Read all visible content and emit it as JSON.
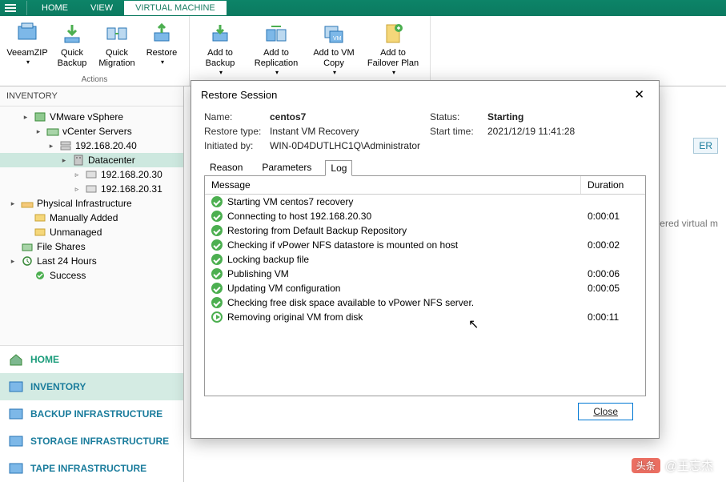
{
  "menubar": {
    "tabs": [
      "HOME",
      "VIEW",
      "VIRTUAL MACHINE"
    ],
    "active": 2
  },
  "ribbon": {
    "groups": [
      {
        "label": "Actions",
        "items": [
          {
            "label": "VeeamZIP",
            "hasDrop": true
          },
          {
            "label": "Quick Backup"
          },
          {
            "label": "Quick Migration"
          },
          {
            "label": "Restore",
            "hasDrop": true
          }
        ]
      },
      {
        "label": "",
        "items": [
          {
            "label": "Add to Backup",
            "hasDrop": true
          },
          {
            "label": "Add to Replication",
            "hasDrop": true
          },
          {
            "label": "Add to VM Copy",
            "hasDrop": true
          },
          {
            "label": "Add to Failover Plan",
            "hasDrop": true
          }
        ]
      }
    ]
  },
  "sidebar": {
    "title": "INVENTORY",
    "tree": [
      {
        "depth": 1,
        "toggle": "▸",
        "icon": "vi",
        "label": "VMware vSphere"
      },
      {
        "depth": 2,
        "toggle": "▸",
        "icon": "vc",
        "label": "vCenter Servers"
      },
      {
        "depth": 3,
        "toggle": "▸",
        "icon": "srv",
        "label": "192.168.20.40"
      },
      {
        "depth": 4,
        "toggle": "▸",
        "icon": "dc",
        "label": "Datacenter",
        "selected": true
      },
      {
        "depth": 5,
        "toggle": "▹",
        "icon": "host",
        "label": "192.168.20.30"
      },
      {
        "depth": 5,
        "toggle": "▹",
        "icon": "host",
        "label": "192.168.20.31"
      },
      {
        "depth": 0,
        "toggle": "▸",
        "icon": "phys",
        "label": "Physical Infrastructure"
      },
      {
        "depth": 1,
        "toggle": "",
        "icon": "man",
        "label": "Manually Added"
      },
      {
        "depth": 1,
        "toggle": "",
        "icon": "unm",
        "label": "Unmanaged"
      },
      {
        "depth": 0,
        "toggle": "",
        "icon": "fs",
        "label": "File Shares"
      },
      {
        "depth": 0,
        "toggle": "▸",
        "icon": "hist",
        "label": "Last 24 Hours"
      },
      {
        "depth": 1,
        "toggle": "",
        "icon": "succ",
        "label": "Success"
      }
    ],
    "nav": [
      {
        "label": "HOME",
        "type": "home"
      },
      {
        "label": "INVENTORY",
        "type": "section",
        "active": true
      },
      {
        "label": "BACKUP INFRASTRUCTURE",
        "type": "section"
      },
      {
        "label": "STORAGE INFRASTRUCTURE",
        "type": "section"
      },
      {
        "label": "TAPE INFRASTRUCTURE",
        "type": "section"
      }
    ]
  },
  "content": {
    "fragHeader": "ER",
    "fragText": "vered virtual m"
  },
  "dialog": {
    "title": "Restore Session",
    "info": {
      "name_label": "Name:",
      "name": "centos7",
      "type_label": "Restore type:",
      "type": "Instant VM Recovery",
      "init_label": "Initiated by:",
      "init": "WIN-0D4DUTLHC1Q\\Administrator",
      "status_label": "Status:",
      "status": "Starting",
      "time_label": "Start time:",
      "time": "2021/12/19 11:41:28"
    },
    "tabs": [
      "Reason",
      "Parameters",
      "Log"
    ],
    "activeTab": 2,
    "log": {
      "cols": [
        "Message",
        "Duration"
      ],
      "rows": [
        {
          "status": "ok",
          "msg": "Starting VM centos7 recovery",
          "dur": ""
        },
        {
          "status": "ok",
          "msg": "Connecting to host 192.168.20.30",
          "dur": "0:00:01"
        },
        {
          "status": "ok",
          "msg": "Restoring from Default Backup Repository",
          "dur": ""
        },
        {
          "status": "ok",
          "msg": "Checking if vPower NFS datastore is mounted on host",
          "dur": "0:00:02"
        },
        {
          "status": "ok",
          "msg": "Locking backup file",
          "dur": ""
        },
        {
          "status": "ok",
          "msg": "Publishing VM",
          "dur": "0:00:06"
        },
        {
          "status": "ok",
          "msg": "Updating VM configuration",
          "dur": "0:00:05"
        },
        {
          "status": "ok",
          "msg": "Checking free disk space available to vPower NFS server.",
          "dur": ""
        },
        {
          "status": "run",
          "msg": "Removing original VM from disk",
          "dur": "0:00:11"
        }
      ]
    },
    "close_btn": "Close"
  },
  "watermark": {
    "badge": "头条",
    "text": "@王忘杰"
  }
}
